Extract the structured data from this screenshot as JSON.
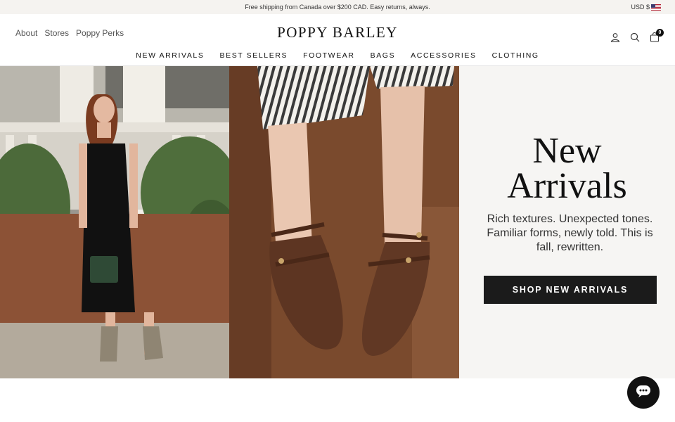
{
  "announcement": {
    "text": "Free shipping from Canada over $200 CAD. Easy returns, always.",
    "currency": "USD $"
  },
  "header": {
    "util_links": [
      "About",
      "Stores",
      "Poppy Perks"
    ],
    "logo": "POPPY BARLEY",
    "icons": [
      "account-icon",
      "search-icon",
      "cart-icon"
    ],
    "cart_count": "0",
    "nav": [
      "NEW ARRIVALS",
      "BEST SELLERS",
      "FOOTWEAR",
      "BAGS",
      "ACCESSORIES",
      "CLOTHING"
    ]
  },
  "hero": {
    "title": "New\nArrivals",
    "subtitle": "Rich textures. Unexpected tones. Familiar forms, newly told. This is fall, rewritten.",
    "button": "SHOP NEW ARRIVALS"
  },
  "chat": {
    "icon": "chat-icon"
  }
}
